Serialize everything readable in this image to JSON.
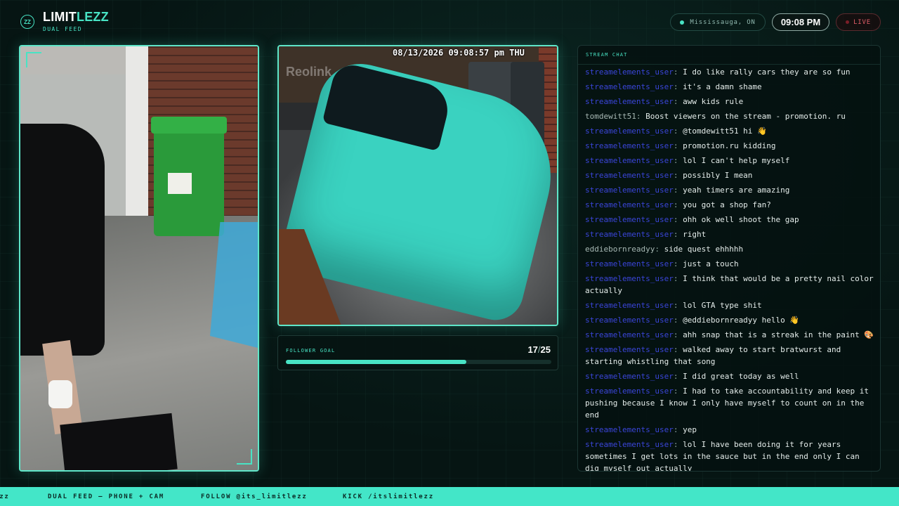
{
  "header": {
    "logo_badge": "ZZ",
    "brand_primary": "LIMIT",
    "brand_accent": "LEZZ",
    "subtitle": "DUAL FEED",
    "location": "Mississauga, ON",
    "time": "09:08 PM",
    "live_label": "LIVE"
  },
  "camera": {
    "timestamp": "08/13/2026 09:08:57 pm THU",
    "watermark": "Reolink"
  },
  "follower_goal": {
    "label": "FOLLOWER GOAL",
    "current": "17",
    "separator": "/",
    "target": "25",
    "progress": 0.68
  },
  "chat": {
    "title": "STREAM CHAT",
    "messages": [
      {
        "user": "streamelements_user",
        "text": "I do like rally cars they are so fun",
        "user_color": "blue"
      },
      {
        "user": "streamelements_user",
        "text": "it's a damn shame",
        "user_color": "blue"
      },
      {
        "user": "streamelements_user",
        "text": "aww kids rule",
        "user_color": "blue"
      },
      {
        "user": "tomdewitt51",
        "text": "Boost viewers on the stream - promotion. ru",
        "user_color": "gray"
      },
      {
        "user": "streamelements_user",
        "text": "@tomdewitt51 hi 👋",
        "user_color": "blue"
      },
      {
        "user": "streamelements_user",
        "text": "promotion.ru kidding",
        "user_color": "blue"
      },
      {
        "user": "streamelements_user",
        "text": "lol I can't help myself",
        "user_color": "blue"
      },
      {
        "user": "streamelements_user",
        "text": "possibly I mean",
        "user_color": "blue"
      },
      {
        "user": "streamelements_user",
        "text": "yeah timers are amazing",
        "user_color": "blue"
      },
      {
        "user": "streamelements_user",
        "text": "you got a shop fan?",
        "user_color": "blue"
      },
      {
        "user": "streamelements_user",
        "text": "ohh ok well shoot the gap",
        "user_color": "blue"
      },
      {
        "user": "streamelements_user",
        "text": "right",
        "user_color": "blue"
      },
      {
        "user": "eddiebornreadyy",
        "text": "side quest ehhhhh",
        "user_color": "gray"
      },
      {
        "user": "streamelements_user",
        "text": "just a touch",
        "user_color": "blue"
      },
      {
        "user": "streamelements_user",
        "text": "I think that would be a pretty nail color actually",
        "user_color": "blue"
      },
      {
        "user": "streamelements_user",
        "text": "lol GTA type shit",
        "user_color": "blue"
      },
      {
        "user": "streamelements_user",
        "text": "@eddiebornreadyy hello 👋",
        "user_color": "blue"
      },
      {
        "user": "streamelements_user",
        "text": "ahh snap that is a streak in the paint 🎨",
        "user_color": "blue"
      },
      {
        "user": "streamelements_user",
        "text": "walked away to start bratwurst and starting whistling that song",
        "user_color": "blue"
      },
      {
        "user": "streamelements_user",
        "text": "I did great today as well",
        "user_color": "blue"
      },
      {
        "user": "streamelements_user",
        "text": "I had to take accountability and keep it pushing because I know I only have myself to count on in the end",
        "user_color": "blue"
      },
      {
        "user": "streamelements_user",
        "text": "yep",
        "user_color": "blue"
      },
      {
        "user": "streamelements_user",
        "text": "lol I have been doing it for years sometimes I get lots in the sauce but in the end only I can dig myself out actually",
        "user_color": "blue"
      }
    ]
  },
  "ticker": {
    "items": [
      "ezz",
      "DUAL FEED — PHONE + CAM",
      "FOLLOW @its_limitlezz",
      "KICK /itslimitlezz"
    ]
  },
  "colors": {
    "accent": "#48e3c4",
    "background": "#061513",
    "live": "#e05d68",
    "chat_user_blue": "#3a45d8",
    "chat_user_gray": "#a7b8b4"
  }
}
